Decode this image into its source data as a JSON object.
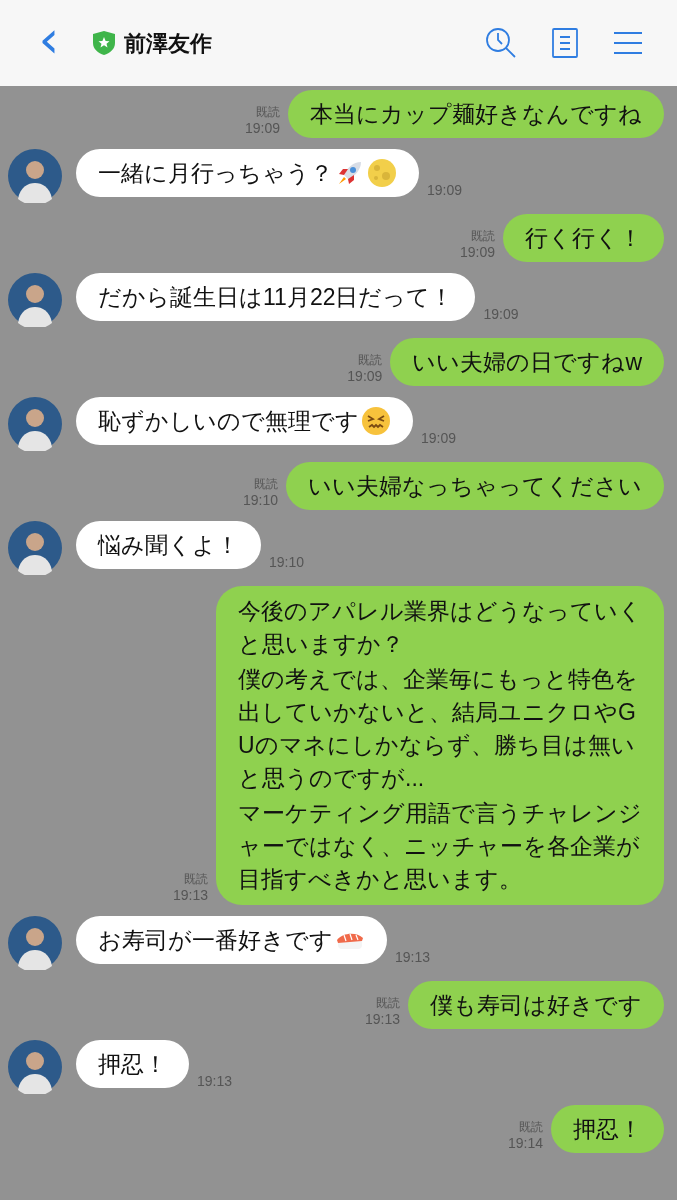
{
  "header": {
    "back": "‹",
    "title": "前澤友作",
    "verified": true
  },
  "messages": [
    {
      "kind": "outgoing",
      "paragraphs": [
        "本当にカップ麺好きなんですね"
      ],
      "read": "既読",
      "time": "19:09"
    },
    {
      "kind": "incoming",
      "paragraphs": [
        "一緒に月行っちゃう？"
      ],
      "emoji": [
        {
          "kind": "rocket"
        },
        {
          "kind": "moon"
        }
      ],
      "time": "19:09"
    },
    {
      "kind": "outgoing",
      "paragraphs": [
        "行く行く！"
      ],
      "read": "既読",
      "time": "19:09"
    },
    {
      "kind": "incoming",
      "paragraphs": [
        "だから誕生日は11月22日だって！"
      ],
      "time": "19:09"
    },
    {
      "kind": "outgoing",
      "paragraphs": [
        "いい夫婦の日ですねw"
      ],
      "read": "既読",
      "time": "19:09"
    },
    {
      "kind": "incoming",
      "paragraphs": [
        "恥ずかしいので無理です"
      ],
      "emoji": [
        {
          "kind": "confounded"
        }
      ],
      "time": "19:09"
    },
    {
      "kind": "outgoing",
      "paragraphs": [
        "いい夫婦なっちゃってください"
      ],
      "read": "既読",
      "time": "19:10"
    },
    {
      "kind": "incoming",
      "paragraphs": [
        "悩み聞くよ！"
      ],
      "time": "19:10"
    },
    {
      "kind": "outgoing",
      "paragraphs": [
        "今後のアパレル業界はどうなっていくと思いますか？",
        "僕の考えでは、企業毎にもっと特色を出していかないと、結局ユニクロやGUのマネにしかならず、勝ち目は無いと思うのですが...",
        "マーケティング用語で言うチャレンジャーではなく、ニッチャーを各企業が目指すべきかと思います。"
      ],
      "read": "既読",
      "time": "19:13"
    },
    {
      "kind": "incoming",
      "paragraphs": [
        "お寿司が一番好きです"
      ],
      "emoji": [
        {
          "kind": "sushi"
        }
      ],
      "time": "19:13"
    },
    {
      "kind": "outgoing",
      "paragraphs": [
        "僕も寿司は好きです"
      ],
      "read": "既読",
      "time": "19:13"
    },
    {
      "kind": "incoming",
      "paragraphs": [
        "押忍！"
      ],
      "time": "19:13"
    },
    {
      "kind": "outgoing",
      "paragraphs": [
        "押忍！"
      ],
      "read": "既読",
      "time": "19:14"
    }
  ]
}
